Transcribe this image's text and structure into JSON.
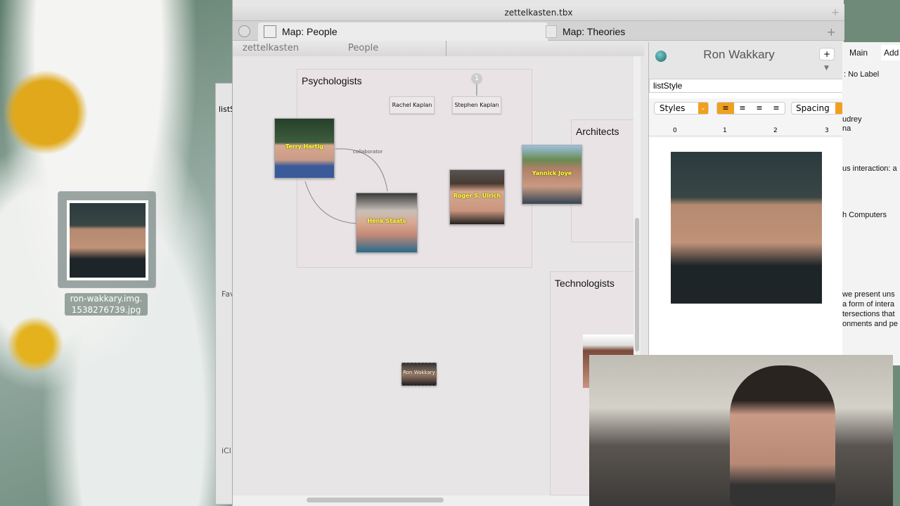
{
  "desktop": {
    "file_label": "ron-wakkary.img.\n1538276739.jpg",
    "file_label_lines": [
      "ron-wakkary.img.",
      "1538276739.jpg"
    ]
  },
  "behind_window": {
    "field": "listS",
    "sidebar_favorites": "Fav",
    "sidebar_icloud": "iCl"
  },
  "window": {
    "title": "zettelkasten.tbx"
  },
  "tabs": [
    {
      "label": "Map: People",
      "active": true
    },
    {
      "label": "Map: Theories",
      "active": false
    }
  ],
  "breadcrumb": [
    "zettelkasten",
    "People"
  ],
  "map": {
    "adornments": [
      {
        "label": "Psychologists"
      },
      {
        "label": "Architects"
      },
      {
        "label": "Technologists"
      }
    ],
    "notes": [
      {
        "label": "Rachel Kaplan"
      },
      {
        "label": "Stephen Kaplan"
      }
    ],
    "badge": "1",
    "people": [
      {
        "label": "Terry Hartig"
      },
      {
        "label": "Henk Staats"
      },
      {
        "label": "Roger S. Ulrich"
      },
      {
        "label": "Yannick Joye"
      },
      {
        "label": "Ron Wakkary"
      }
    ],
    "link_label": "collaborator"
  },
  "inspector": {
    "title": "Ron Wakkary",
    "attribute": "listStyle",
    "styles_label": "Styles",
    "spacing_label": "Spacing",
    "ruler": [
      "0",
      "1",
      "2",
      "3"
    ],
    "add_label": "+",
    "accent": "#f0a020"
  },
  "right_window": {
    "tabs": [
      "Main",
      "Add"
    ],
    "label": ": No Label",
    "lines": [
      "udrey",
      "na",
      "us interaction: a",
      "h Computers",
      "we present uns",
      "a form of intera",
      "tersections that",
      "onments and pe"
    ]
  }
}
